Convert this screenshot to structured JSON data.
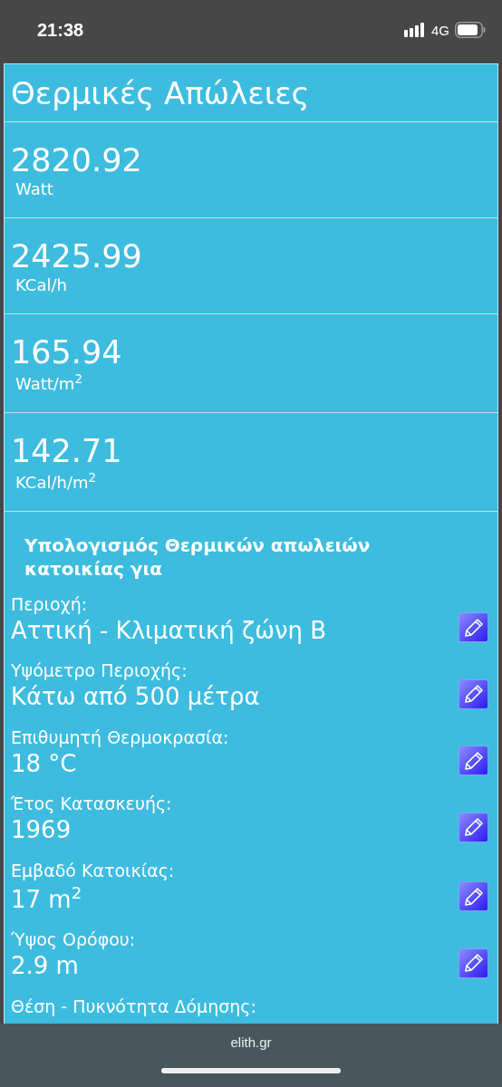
{
  "status_bar": {
    "time": "21:38",
    "network": "4G"
  },
  "header": {
    "title": "Θερμικές Απώλειες"
  },
  "results": [
    {
      "value": "2820.92",
      "unit": "Watt"
    },
    {
      "value": "2425.99",
      "unit": "KCal/h"
    },
    {
      "value": "165.94",
      "unit": "Watt/m$^{2}$"
    },
    {
      "value": "142.71",
      "unit": "KCal/h/m$^{2}$"
    }
  ],
  "section_title": "Υπολογισμός Θερμικών απωλειών κατοικίας για",
  "fields": [
    {
      "label": "Περιοχή:",
      "value": "Αττική - Κλιματική ζώνη Β"
    },
    {
      "label": "Υψόμετρο Περιοχής:",
      "value": "Κάτω από 500 μέτρα"
    },
    {
      "label": "Επιθυμητή Θερμοκρασία:",
      "value": "18 °C"
    },
    {
      "label": "Έτος Κατασκευής:",
      "value": "1969"
    },
    {
      "label": "Εμβαδό Κατοικίας:",
      "value": "17 m$^{2}$"
    },
    {
      "label": "Ύψος Ορόφου:",
      "value": "2.9 m"
    },
    {
      "label": "Θέση - Πυκνότητα Δόμησης:"
    }
  ],
  "browser_bar": {
    "address": "elith.gr"
  }
}
